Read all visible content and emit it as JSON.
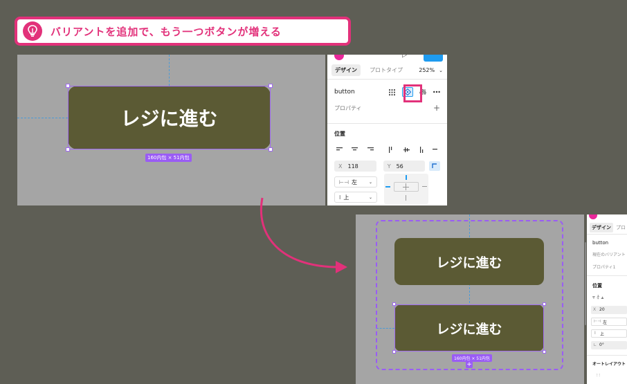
{
  "tip": {
    "icon": "lightbulb-icon",
    "text": "バリアントを追加で、もう一つボタンが増える",
    "color": "#e2317a"
  },
  "before": {
    "button_label": "レジに進む",
    "size_label": "160内包 × 51内包",
    "panel": {
      "tab_design": "デザイン",
      "tab_prototype": "プロトタイプ",
      "zoom": "252%",
      "component_name": "button",
      "more_icon": "•••",
      "properties_label": "プロパティ",
      "add_icon": "+",
      "position_title": "位置",
      "x_label": "X",
      "x_value": "118",
      "y_label": "Y",
      "y_value": "56",
      "h_constraint": "左",
      "v_constraint": "上"
    }
  },
  "after": {
    "button1_label": "レジに進む",
    "button2_label": "レジに進む",
    "size_label": "160内包 × 51内包",
    "add_variant": "+",
    "panel": {
      "tab_design": "デザイン",
      "tab_prototype": "プロ",
      "component_name": "button",
      "current_variant": "現在のバリアント",
      "property1": "プロパティ1",
      "position_title": "位置",
      "x_label": "X",
      "x_value": "20",
      "h_constraint": "左",
      "v_constraint": "上",
      "rotation": "0°",
      "auto_layout": "オートレイアウト"
    }
  },
  "colors": {
    "background": "#5e5e55",
    "canvas": "#a5a5a5",
    "button": "#5b5a34",
    "selection": "#a06af2",
    "accent": "#e2317a",
    "figma_blue": "#1e9bf0"
  }
}
